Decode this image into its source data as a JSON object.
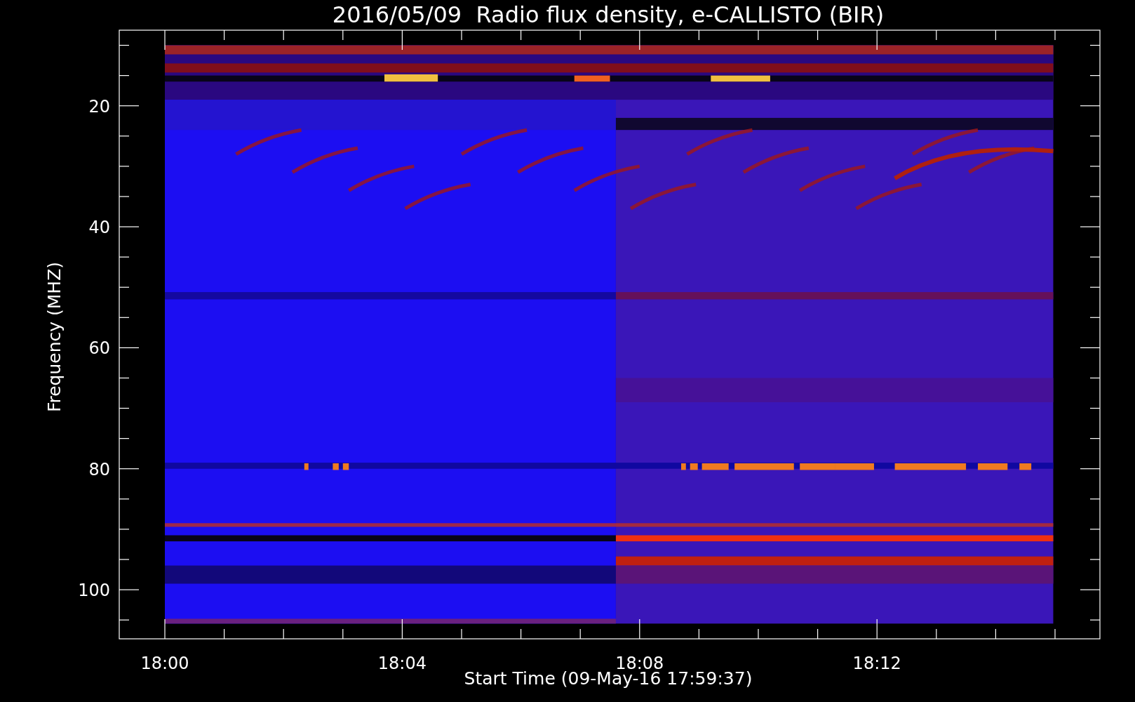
{
  "title": "2016/05/09  Radio flux density, e-CALLISTO (BIR)",
  "y_axis": {
    "label": "Frequency (MHZ)",
    "ticks": [
      "20",
      "40",
      "60",
      "80",
      "100"
    ]
  },
  "x_axis": {
    "label": "Start Time (09-May-16 17:59:37)",
    "ticks": [
      "18:00",
      "18:04",
      "18:08",
      "18:12"
    ]
  }
}
